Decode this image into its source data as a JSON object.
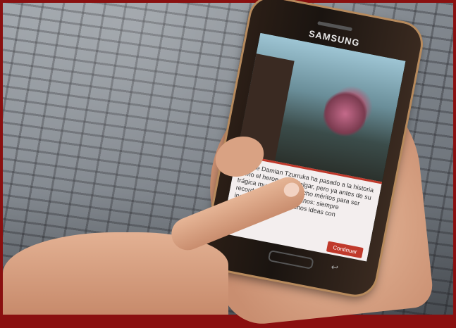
{
  "phone": {
    "brand": "SAMSUNG",
    "story_text": "Xosme Damian Tzurruka ha pasado a la historia como el heroe de Trafalgar, pero ya antes de su trágica muerte habia hecho méritos para ser recordado por los gaditanos: siempre inquietudes como muchos ideas con",
    "continue_label": "Continuar",
    "accent_color": "#c0392b"
  },
  "scene_icons": [
    "building",
    "tree"
  ]
}
